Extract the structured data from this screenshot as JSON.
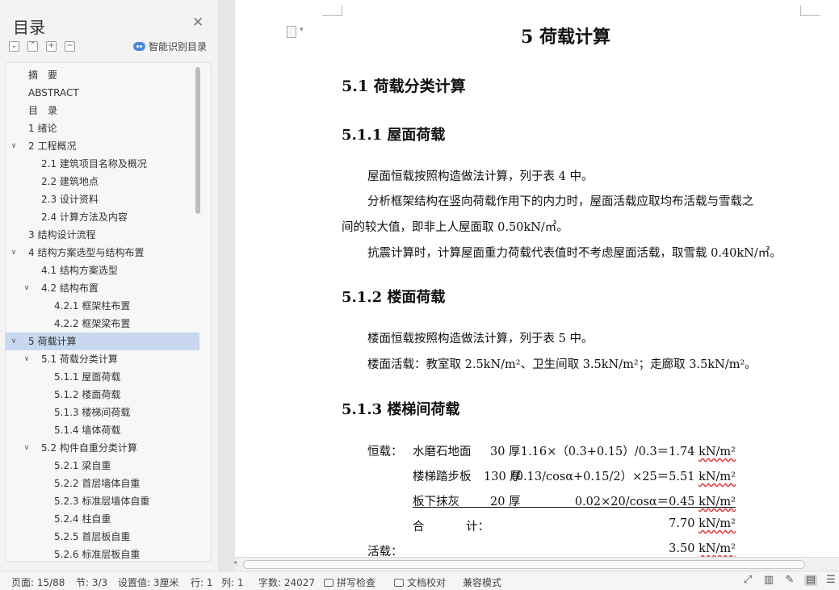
{
  "sidebar": {
    "title": "目录",
    "smart_toc": "智能识别目录",
    "tools": [
      "⌄",
      "⌃",
      "+",
      "−"
    ],
    "toc": [
      {
        "label": "摘　要",
        "level": 1,
        "chevron": ""
      },
      {
        "label": "ABSTRACT",
        "level": 1,
        "chevron": ""
      },
      {
        "label": "目　录",
        "level": 1,
        "chevron": ""
      },
      {
        "label": "1 绪论",
        "level": 1,
        "chevron": ""
      },
      {
        "label": "2 工程概况",
        "level": 1,
        "chevron": "∨"
      },
      {
        "label": "2.1 建筑项目名称及概况",
        "level": 2,
        "chevron": ""
      },
      {
        "label": "2.2 建筑地点",
        "level": 2,
        "chevron": ""
      },
      {
        "label": "2.3  设计资料",
        "level": 2,
        "chevron": ""
      },
      {
        "label": "2.4 计算方法及内容",
        "level": 2,
        "chevron": ""
      },
      {
        "label": "3 结构设计流程",
        "level": 1,
        "chevron": ""
      },
      {
        "label": "4 结构方案选型与结构布置",
        "level": 1,
        "chevron": "∨"
      },
      {
        "label": "4.1 结构方案选型",
        "level": 2,
        "chevron": ""
      },
      {
        "label": "4.2 结构布置",
        "level": 2,
        "chevron": "∨"
      },
      {
        "label": "4.2.1 框架柱布置",
        "level": 3,
        "chevron": ""
      },
      {
        "label": "4.2.2 框架梁布置",
        "level": 3,
        "chevron": ""
      },
      {
        "label": "5 荷载计算",
        "level": 1,
        "chevron": "∨",
        "selected": true
      },
      {
        "label": "5.1 荷载分类计算",
        "level": 2,
        "chevron": "∨"
      },
      {
        "label": "5.1.1 屋面荷载",
        "level": 3,
        "chevron": ""
      },
      {
        "label": "5.1.2 楼面荷载",
        "level": 3,
        "chevron": ""
      },
      {
        "label": "5.1.3 楼梯间荷载",
        "level": 3,
        "chevron": ""
      },
      {
        "label": "5.1.4 墙体荷载",
        "level": 3,
        "chevron": ""
      },
      {
        "label": "5.2 构件自重分类计算",
        "level": 2,
        "chevron": "∨"
      },
      {
        "label": "5.2.1 梁自重",
        "level": 3,
        "chevron": ""
      },
      {
        "label": "5.2.2 首层墙体自重",
        "level": 3,
        "chevron": ""
      },
      {
        "label": "5.2.3 标准层墙体自重",
        "level": 3,
        "chevron": ""
      },
      {
        "label": "5.2.4 柱自重",
        "level": 3,
        "chevron": ""
      },
      {
        "label": "5.2.5 首层板自重",
        "level": 3,
        "chevron": ""
      },
      {
        "label": "5.2.6 标准层板自重",
        "level": 3,
        "chevron": ""
      }
    ]
  },
  "document": {
    "chapter_title": "5 荷载计算",
    "h_5_1": "5.1 荷载分类计算",
    "h_5_1_1": "5.1.1 屋面荷载",
    "p1": "屋面恒载按照构造做法计算，列于表 4 中。",
    "p2a": "分析框架结构在竖向荷载作用下的内力时，屋面活载应取均布活载与雪载之",
    "p2b": "间的较大值，即非上人屋面取 0.50kN/㎡。",
    "p3": "抗震计算时，计算屋面重力荷载代表值时不考虑屋面活载，取雪载 0.40kN/㎡。",
    "h_5_1_2": "5.1.2 楼面荷载",
    "p4": "楼面恒载按照构造做法计算，列于表 5 中。",
    "p5": "楼面活载：教室取 2.5kN/m²、卫生间取 3.5kN/m²；走廊取 3.5kN/m²。",
    "h_5_1_3": "5.1.3 楼梯间荷载",
    "table": {
      "dead_label": "恒载：",
      "live_label": "活载：",
      "unit": "kN/m²",
      "rows": [
        {
          "item": "水磨石地面",
          "thick": "30 厚",
          "formula": "1.16×（0.3+0.15）/0.3＝1.74"
        },
        {
          "item": "楼梯踏步板",
          "thick": "130 厚",
          "formula": "（0.13/cosα+0.15/2）×25＝5.51"
        },
        {
          "item": "板下抹灰",
          "thick": "20 厚",
          "formula": "0.02×20/cosα＝0.45"
        }
      ],
      "total_label_a": "合",
      "total_label_b": "计：",
      "total_value": "7.70",
      "live_value": "3.50"
    }
  },
  "statusbar": {
    "page": "页面: 15/88",
    "section": "节: 3/3",
    "setting": "设置值: 3厘米",
    "row": "行: 1",
    "col": "列: 1",
    "words": "字数: 24027",
    "spellcheck": "拼写检查",
    "doc_check": "文档校对",
    "compat": "兼容模式"
  }
}
